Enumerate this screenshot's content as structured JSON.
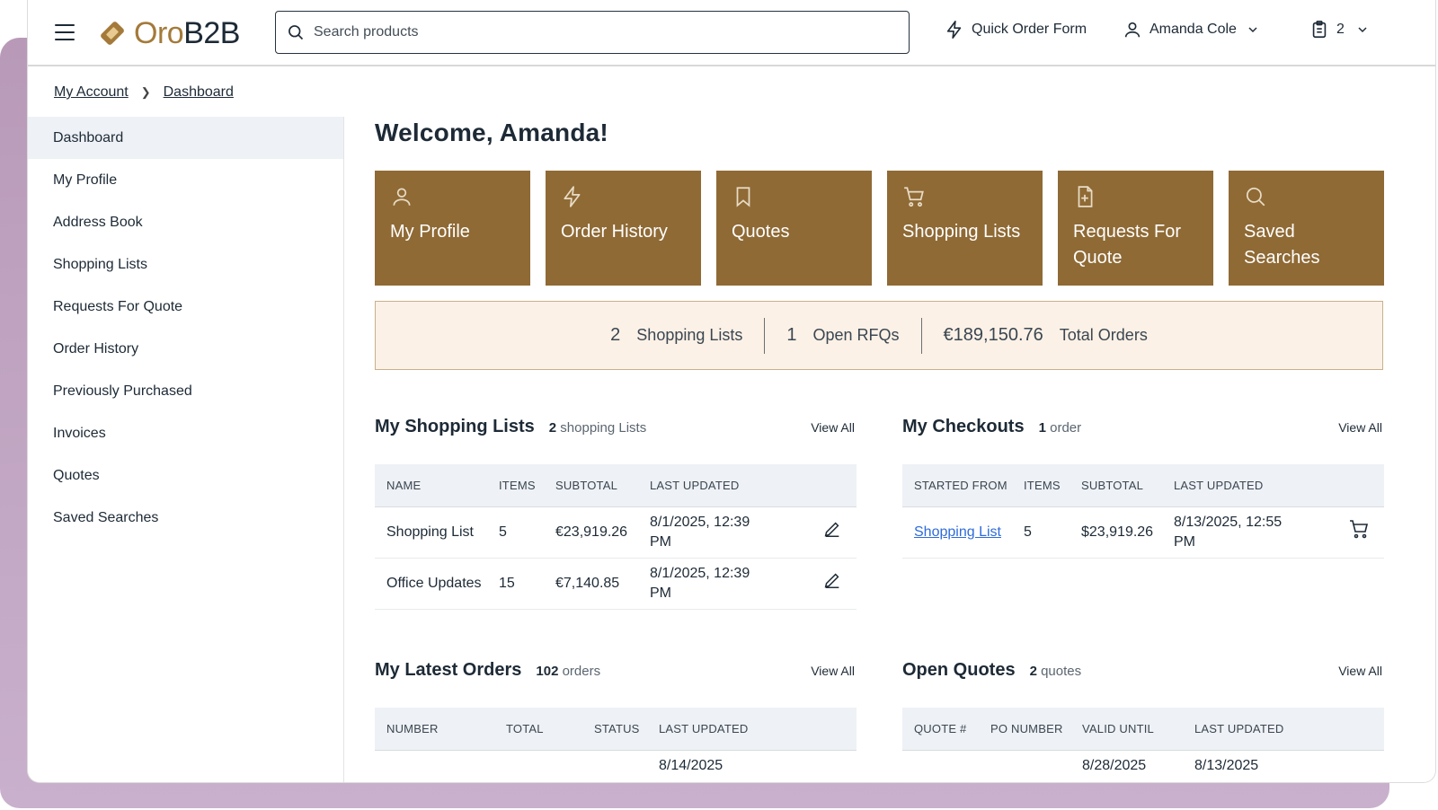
{
  "header": {
    "brand_prefix": "Oro",
    "brand_suffix": "B2B",
    "search_placeholder": "Search products",
    "quick_order": "Quick Order Form",
    "user_name": "Amanda Cole",
    "cart_count": "2"
  },
  "breadcrumb": {
    "root": "My Account",
    "current": "Dashboard"
  },
  "sidebar": {
    "items": [
      {
        "label": "Dashboard"
      },
      {
        "label": "My Profile"
      },
      {
        "label": "Address Book"
      },
      {
        "label": "Shopping Lists"
      },
      {
        "label": "Requests For Quote"
      },
      {
        "label": "Order History"
      },
      {
        "label": "Previously Purchased"
      },
      {
        "label": "Invoices"
      },
      {
        "label": "Quotes"
      },
      {
        "label": "Saved Searches"
      }
    ]
  },
  "main": {
    "welcome": "Welcome, Amanda!",
    "tiles": [
      {
        "label": "My Profile",
        "icon": "user-icon"
      },
      {
        "label": "Order History",
        "icon": "lightning-icon"
      },
      {
        "label": "Quotes",
        "icon": "bookmark-icon"
      },
      {
        "label": "Shopping Lists",
        "icon": "cart-icon"
      },
      {
        "label": "Requests For Quote",
        "icon": "file-plus-icon"
      },
      {
        "label": "Saved Searches",
        "icon": "search-icon"
      }
    ],
    "stats": [
      {
        "value": "2",
        "label": "Shopping Lists"
      },
      {
        "value": "1",
        "label": "Open RFQs"
      },
      {
        "value": "€189,150.76",
        "label": "Total Orders"
      }
    ]
  },
  "shopping_lists": {
    "title": "My Shopping Lists",
    "count_num": "2",
    "count_label": "shopping Lists",
    "view_all": "View All",
    "columns": [
      "NAME",
      "ITEMS",
      "SUBTOTAL",
      "LAST UPDATED"
    ],
    "rows": [
      {
        "name": "Shopping List",
        "items": "5",
        "subtotal": "€23,919.26",
        "updated": "8/1/2025, 12:39 PM"
      },
      {
        "name": "Office Updates",
        "items": "15",
        "subtotal": "€7,140.85",
        "updated": "8/1/2025, 12:39 PM"
      }
    ]
  },
  "checkouts": {
    "title": "My Checkouts",
    "count_num": "1",
    "count_label": "order",
    "view_all": "View All",
    "columns": [
      "STARTED FROM",
      "ITEMS",
      "SUBTOTAL",
      "LAST UPDATED"
    ],
    "rows": [
      {
        "from": "Shopping List",
        "items": "5",
        "subtotal": "$23,919.26",
        "updated": "8/13/2025, 12:55 PM"
      }
    ]
  },
  "orders": {
    "title": "My Latest Orders",
    "count_num": "102",
    "count_label": "orders",
    "view_all": "View All",
    "columns": [
      "NUMBER",
      "TOTAL",
      "STATUS",
      "LAST UPDATED"
    ],
    "rows": [
      {
        "number": "",
        "total": "",
        "status": "",
        "updated": "8/14/2025"
      }
    ]
  },
  "quotes": {
    "title": "Open Quotes",
    "count_num": "2",
    "count_label": "quotes",
    "view_all": "View All",
    "columns": [
      "QUOTE #",
      "PO NUMBER",
      "VALID UNTIL",
      "LAST UPDATED"
    ],
    "rows": [
      {
        "quote": "",
        "po": "",
        "valid": "8/28/2025",
        "updated": "8/13/2025"
      }
    ]
  },
  "colors": {
    "tile_bg": "#8f6a35",
    "stats_bg": "#fcf1e6",
    "brand_accent": "#a47a3a",
    "link": "#2f6bd9"
  }
}
